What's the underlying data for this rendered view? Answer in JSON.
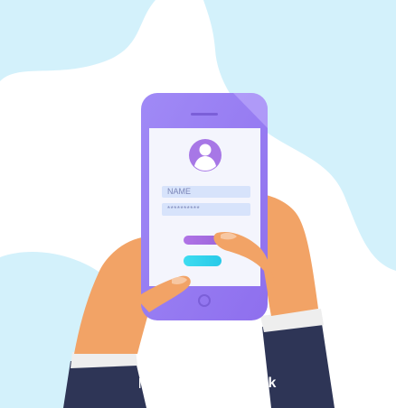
{
  "login": {
    "name_placeholder": "NAME",
    "password_mask": "**********"
  },
  "credit": {
    "prefix": "lesigned by",
    "brand": "freepik"
  },
  "icons": {
    "avatar": "user-avatar-icon",
    "logo": "freepik-logo-icon"
  },
  "colors": {
    "background_blob": "#d3f1fb",
    "phone_body": "#9a7cf2",
    "screen": "#f4f5fd",
    "input_fill": "#d7e3fb",
    "primary_button": "#a86ee0",
    "secondary_button": "#33d6ee",
    "skin": "#f2a366",
    "sleeve": "#2e3556",
    "cuff": "#eeeeee"
  }
}
